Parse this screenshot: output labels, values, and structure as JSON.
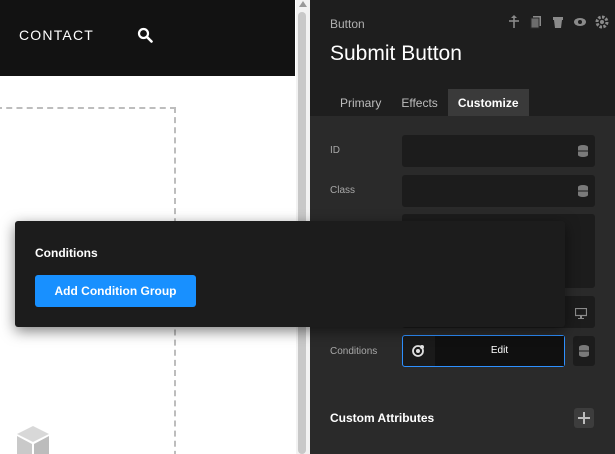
{
  "nav": {
    "contact_label": "CONTACT",
    "search_icon": "search-icon"
  },
  "panel": {
    "element_type": "Button",
    "element_name": "Submit Button",
    "header_icons": [
      "align-icon",
      "copy-icon",
      "delete-icon",
      "visibility-icon",
      "settings-icon"
    ],
    "tabs": [
      {
        "label": "Primary",
        "active": false
      },
      {
        "label": "Effects",
        "active": false
      },
      {
        "label": "Customize",
        "active": true
      }
    ],
    "fields": {
      "id_label": "ID",
      "class_label": "Class",
      "conditions_label": "Conditions",
      "conditions_edit": "Edit"
    },
    "custom_attributes_label": "Custom Attributes"
  },
  "popup": {
    "title": "Conditions",
    "add_button": "Add Condition Group"
  },
  "colors": {
    "accent": "#1890ff",
    "panel_bg": "#2a2a2a",
    "nav_bg": "#121212"
  }
}
